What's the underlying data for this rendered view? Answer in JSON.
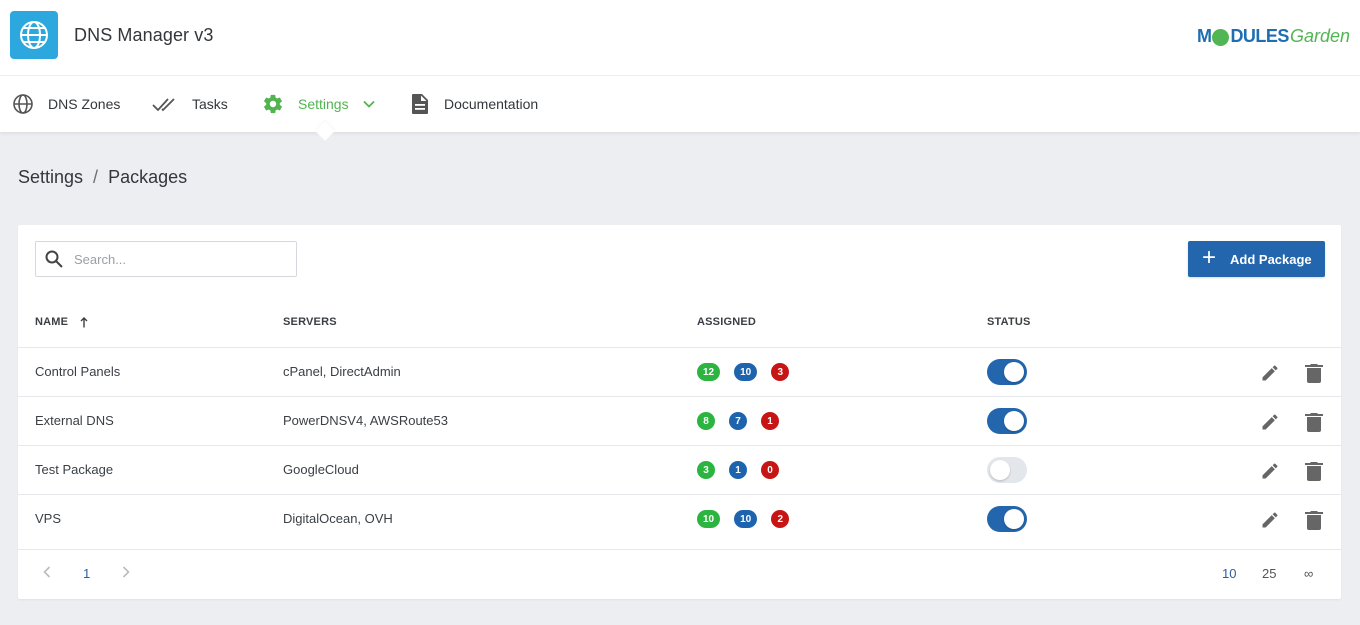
{
  "app": {
    "title": "DNS Manager v3",
    "brand_bold": "M",
    "brand_bold2": "DULES",
    "brand_light": "Garden"
  },
  "nav": [
    {
      "label": "DNS Zones",
      "icon": "globe-icon"
    },
    {
      "label": "Tasks",
      "icon": "double-check-icon"
    },
    {
      "label": "Settings",
      "icon": "gear-icon",
      "active": true
    },
    {
      "label": "Documentation",
      "icon": "document-icon"
    }
  ],
  "breadcrumb": {
    "parent": "Settings",
    "separator": "/",
    "current": "Packages"
  },
  "search": {
    "placeholder": "Search..."
  },
  "add_button": {
    "label": "Add Package"
  },
  "table": {
    "columns": {
      "name": "NAME",
      "servers": "SERVERS",
      "assigned": "ASSIGNED",
      "status": "STATUS"
    },
    "rows": [
      {
        "name": "Control Panels",
        "servers": "cPanel, DirectAdmin",
        "green": "12",
        "blue": "10",
        "red": "3",
        "status": "on"
      },
      {
        "name": "External DNS",
        "servers": "PowerDNSV4, AWSRoute53",
        "green": "8",
        "blue": "7",
        "red": "1",
        "status": "on"
      },
      {
        "name": "Test Package",
        "servers": "GoogleCloud",
        "green": "3",
        "blue": "1",
        "red": "0",
        "status": "off"
      },
      {
        "name": "VPS",
        "servers": "DigitalOcean, OVH",
        "green": "10",
        "blue": "10",
        "red": "2",
        "status": "on"
      }
    ]
  },
  "pagination": {
    "current_page": "1",
    "page_sizes": [
      "10",
      "25",
      "∞"
    ]
  },
  "colors": {
    "accent": "#2366ad",
    "active_nav": "#52b44f",
    "badge_green": "#2bb540",
    "badge_blue": "#1d63ad",
    "badge_red": "#c71515"
  }
}
